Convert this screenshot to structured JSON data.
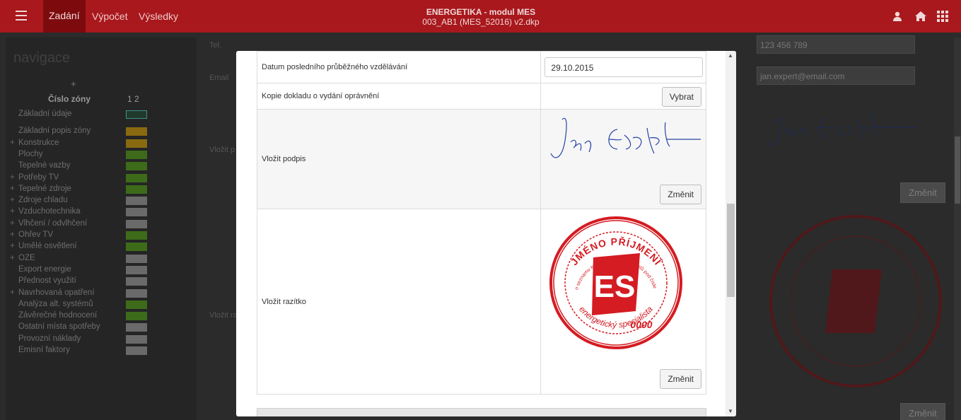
{
  "topbar": {
    "tabs": [
      "Zadání",
      "Výpočet",
      "Výsledky"
    ],
    "title_line1": "ENERGETIKA - modul MES",
    "title_line2": "003_AB1 (MES_52016) v2.dkp",
    "icons": [
      "user-icon",
      "home-icon",
      "apps-grid-icon"
    ]
  },
  "sidebar": {
    "heading": "navigace",
    "plus": "+",
    "zone_header": "Číslo zóny",
    "zone_numbers": "1  2",
    "items": [
      {
        "label": "Základní údaje",
        "expandable": false,
        "color": "#2f4a2f"
      },
      {
        "label": "Základní popis zóny",
        "expandable": false,
        "color": "#8a6a10"
      },
      {
        "label": "Konstrukce",
        "expandable": true,
        "color": "#8a6a10"
      },
      {
        "label": "Plochy",
        "expandable": false,
        "color": "#3d6b1a"
      },
      {
        "label": "Tepelné vazby",
        "expandable": false,
        "color": "#3d6b1a"
      },
      {
        "label": "Potřeby TV",
        "expandable": true,
        "color": "#3d6b1a"
      },
      {
        "label": "Tepelné zdroje",
        "expandable": true,
        "color": "#3d6b1a"
      },
      {
        "label": "Zdroje chladu",
        "expandable": true,
        "color": "#6a6a6a"
      },
      {
        "label": "Vzduchotechnika",
        "expandable": true,
        "color": "#6a6a6a"
      },
      {
        "label": "Vlhčení / odvlhčení",
        "expandable": true,
        "color": "#6a6a6a"
      },
      {
        "label": "Ohřev TV",
        "expandable": true,
        "color": "#3d6b1a"
      },
      {
        "label": "Umělé osvětlení",
        "expandable": true,
        "color": "#3d6b1a"
      },
      {
        "label": "OZE",
        "expandable": true,
        "color": "#6a6a6a"
      },
      {
        "label": "Export energie",
        "expandable": false,
        "color": "#6a6a6a"
      },
      {
        "label": "Přednost využití",
        "expandable": false,
        "color": "#6a6a6a"
      },
      {
        "label": "Navrhovaná opatření",
        "expandable": true,
        "color": "#6a6a6a"
      },
      {
        "label": "Analýza alt. systémů",
        "expandable": false,
        "color": "#3d6b1a"
      },
      {
        "label": "Závěrečné hodnocení",
        "expandable": false,
        "color": "#3d6b1a"
      },
      {
        "label": "Ostatní místa spotřeby",
        "expandable": false,
        "color": "#6a6a6a"
      },
      {
        "label": "Provozní náklady",
        "expandable": false,
        "color": "#6a6a6a"
      },
      {
        "label": "Emisní faktory",
        "expandable": false,
        "color": "#6a6a6a"
      }
    ]
  },
  "background_form": {
    "tel_label": "Tel.",
    "email_label": "Email",
    "sign_label": "Vložit p",
    "stamp_label": "Vložit ra",
    "tel_value": "123 456 789",
    "email_value": "jan.expert@email.com",
    "change_btn": "Změnit"
  },
  "modal": {
    "rows": [
      {
        "label": "Datum posledního průběžného vzdělávání",
        "value": "29.10.2015"
      },
      {
        "label": "Kopie dokladu o vydání oprávnění",
        "button": "Vybrat"
      },
      {
        "label": "Vložit podpis",
        "button": "Změnit"
      },
      {
        "label": "Vložit razítko",
        "button": "Změnit"
      }
    ],
    "stamp": {
      "top_text": "JMÉNO PŘÍJMENÍ",
      "ring_text": "do seznamu energetických specialistů pod číslem",
      "number": "0000",
      "bottom_text": "energetický specialista",
      "logo_letters": "ES",
      "color": "#d41c22"
    },
    "signature_text": "Jan Expert"
  },
  "colors": {
    "topbar": "#a8181c",
    "accent": "#7d0b0e"
  }
}
